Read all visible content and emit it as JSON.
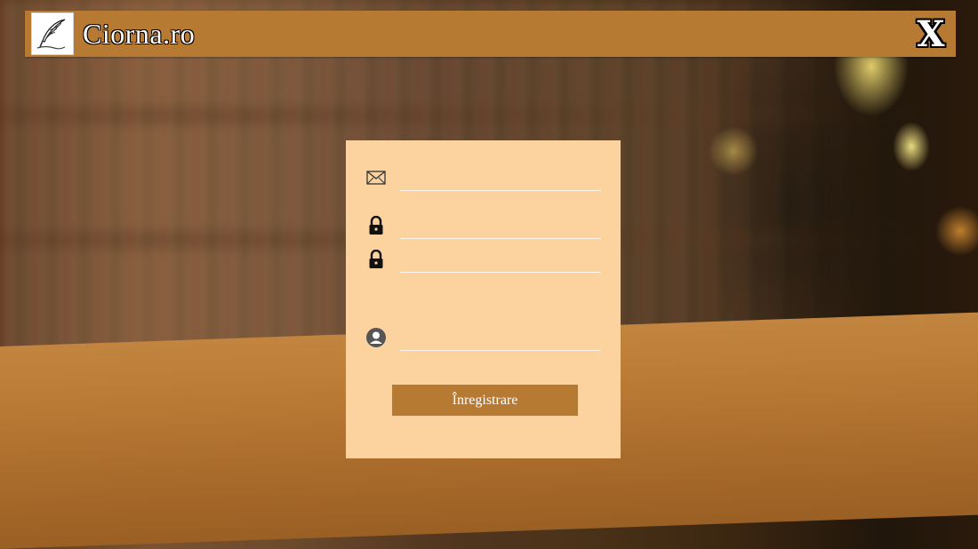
{
  "app": {
    "title": "Ciorna.ro",
    "close_label": "X"
  },
  "form": {
    "email": {
      "icon": "envelope-icon",
      "value": "",
      "placeholder": ""
    },
    "password": {
      "icon": "lock-icon",
      "value": "",
      "placeholder": ""
    },
    "confirm_password": {
      "icon": "lock-icon",
      "value": "",
      "placeholder": ""
    },
    "username": {
      "icon": "user-icon",
      "value": "",
      "placeholder": ""
    },
    "submit_label": "Înregistrare"
  },
  "colors": {
    "accent": "#b77a33",
    "card": "#fcd39f",
    "text_light": "#ffffff"
  }
}
